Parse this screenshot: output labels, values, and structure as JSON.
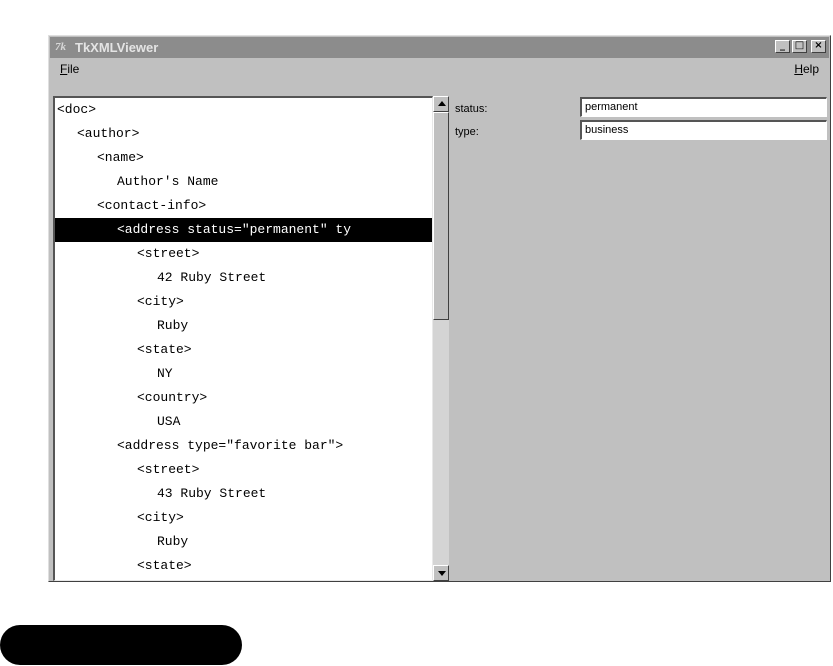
{
  "window": {
    "title": "TkXMLViewer",
    "app_icon": "7k",
    "buttons": {
      "minimize": "_",
      "maximize": "□",
      "close": "×"
    }
  },
  "menubar": {
    "file": {
      "mnemonic": "F",
      "rest": "ile"
    },
    "help": {
      "mnemonic": "H",
      "rest": "elp"
    }
  },
  "tree": {
    "selected_index": 5,
    "rows": [
      {
        "indent": 0,
        "text": "<doc>"
      },
      {
        "indent": 1,
        "text": "<author>"
      },
      {
        "indent": 2,
        "text": "<name>"
      },
      {
        "indent": 3,
        "text": "Author's Name"
      },
      {
        "indent": 2,
        "text": "<contact-info>"
      },
      {
        "indent": 3,
        "text": "<address status=\"permanent\" ty"
      },
      {
        "indent": 4,
        "text": "<street>"
      },
      {
        "indent": 5,
        "text": "42 Ruby Street"
      },
      {
        "indent": 4,
        "text": "<city>"
      },
      {
        "indent": 5,
        "text": "Ruby"
      },
      {
        "indent": 4,
        "text": "<state>"
      },
      {
        "indent": 5,
        "text": "NY"
      },
      {
        "indent": 4,
        "text": "<country>"
      },
      {
        "indent": 5,
        "text": "USA"
      },
      {
        "indent": 3,
        "text": "<address type=\"favorite bar\">"
      },
      {
        "indent": 4,
        "text": "<street>"
      },
      {
        "indent": 5,
        "text": "43 Ruby Street"
      },
      {
        "indent": 4,
        "text": "<city>"
      },
      {
        "indent": 5,
        "text": "Ruby"
      },
      {
        "indent": 4,
        "text": "<state>"
      }
    ]
  },
  "attributes": [
    {
      "label": "status:",
      "value": "permanent"
    },
    {
      "label": "type:",
      "value": "business"
    }
  ]
}
